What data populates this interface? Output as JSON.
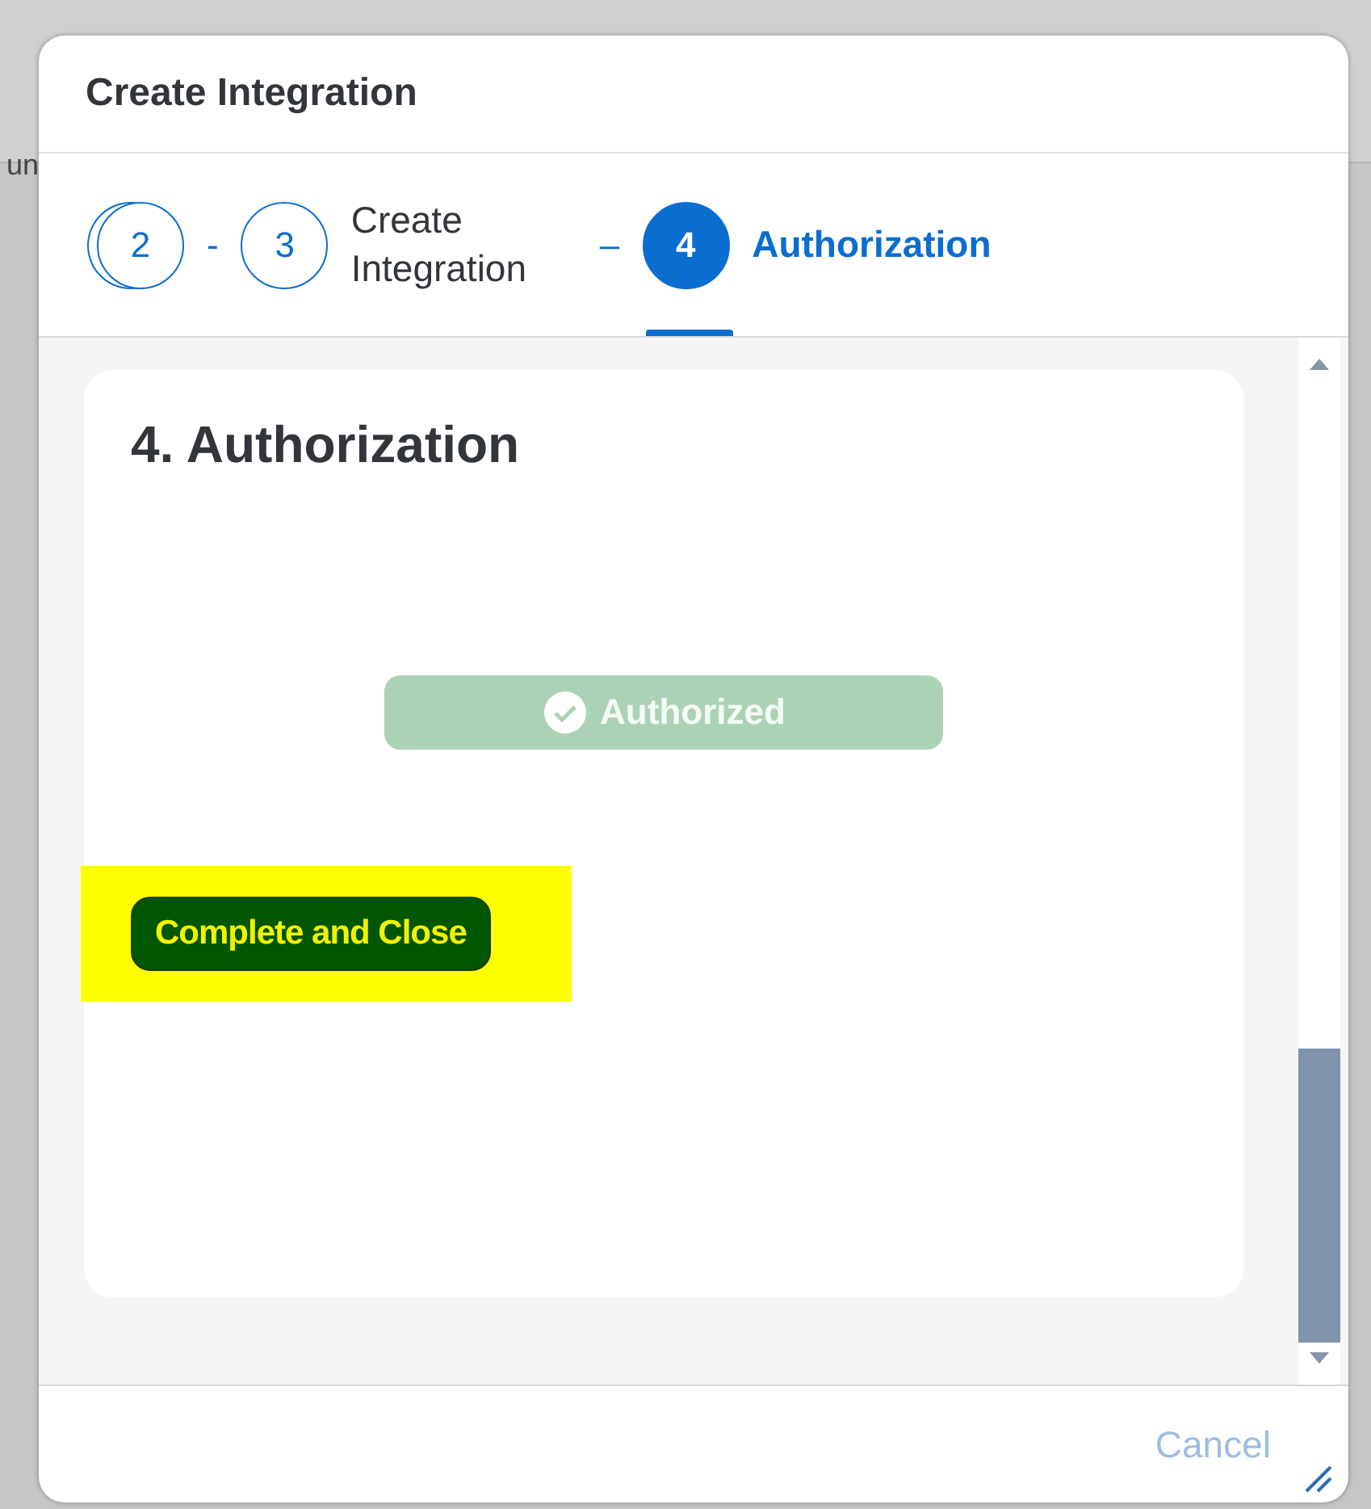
{
  "background": {
    "text": "un"
  },
  "dialog": {
    "title": "Create Integration",
    "steps": [
      {
        "number": "2",
        "separator": "-",
        "stacked": true,
        "selected": false
      },
      {
        "number": "3",
        "label": "Create Integration",
        "separator": "–",
        "stacked": false,
        "selected": false
      },
      {
        "number": "4",
        "label": "Authorization",
        "stacked": false,
        "selected": true
      }
    ],
    "section": {
      "heading": "4. Authorization",
      "status_button": {
        "label": "Authorized",
        "disabled": true
      },
      "complete_button": {
        "label": "Complete and Close",
        "highlighted": true
      }
    },
    "footer": {
      "cancel": {
        "label": "Cancel",
        "disabled": true
      }
    }
  }
}
